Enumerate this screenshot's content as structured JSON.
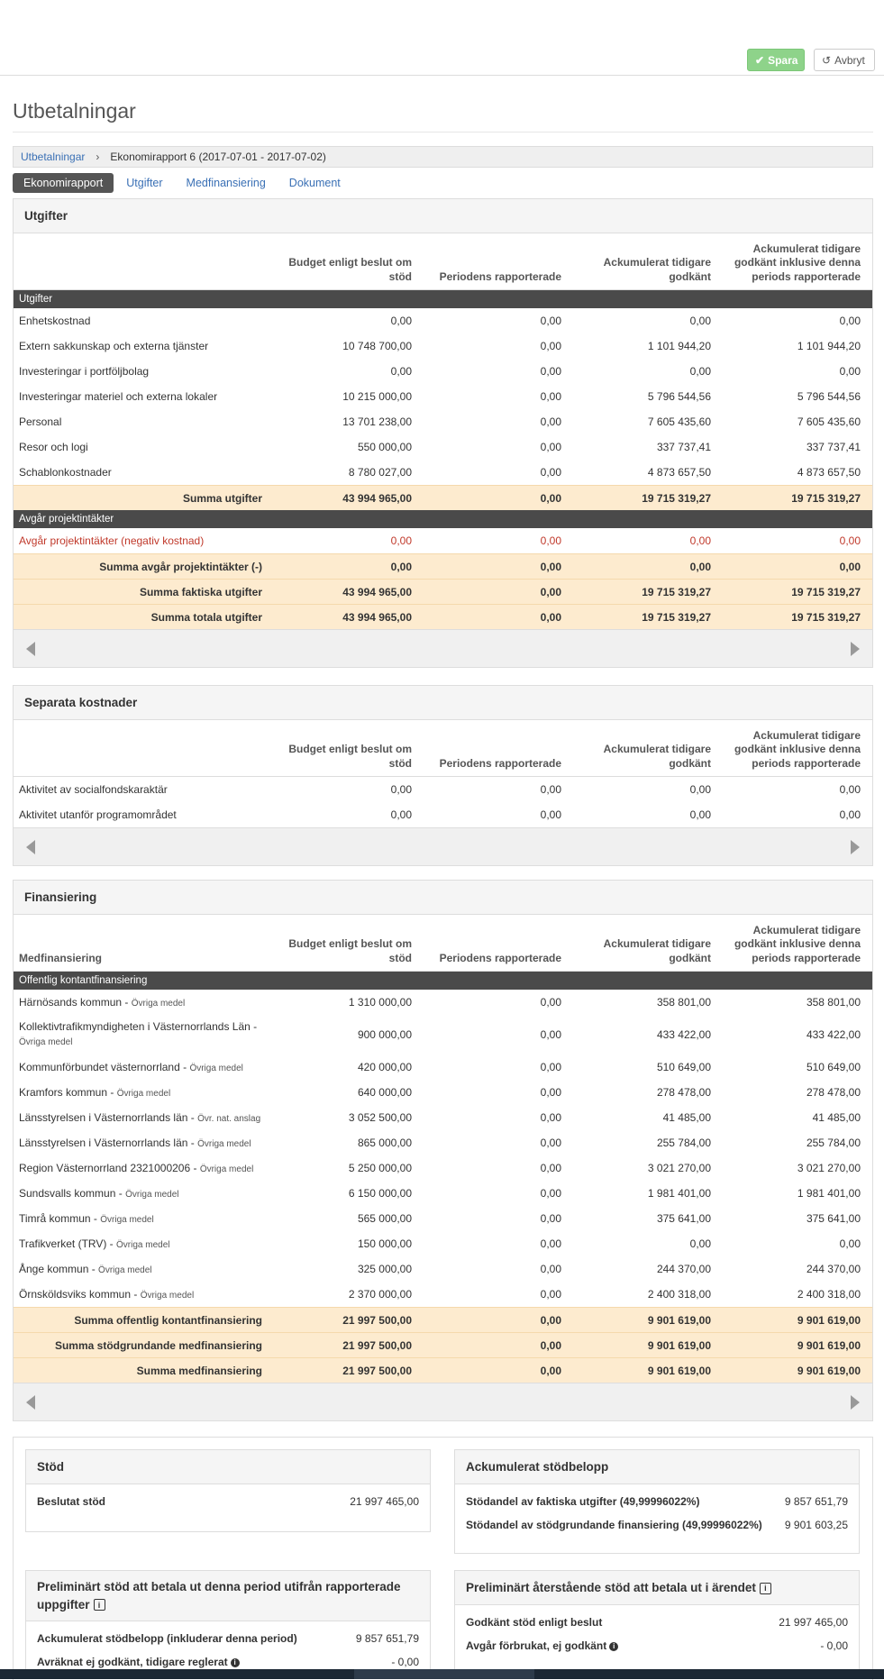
{
  "toolbar": {
    "save_label": "Spara",
    "cancel_label": "Avbryt"
  },
  "page_title": "Utbetalningar",
  "breadcrumb": {
    "link": "Utbetalningar",
    "separator": "›",
    "current": "Ekonomirapport 6 (2017-07-01 - 2017-07-02)"
  },
  "tabs": [
    "Ekonomirapport",
    "Utgifter",
    "Medfinansiering",
    "Dokument"
  ],
  "columns": [
    "Budget enligt beslut om stöd",
    "Periodens rapporterade",
    "Ackumulerat tidigare godkänt",
    "Ackumulerat tidigare godkänt inklusive denna periods rapporterade"
  ],
  "utgifter": {
    "title": "Utgifter",
    "category1": "Utgifter",
    "rows": [
      [
        "Enhetskostnad",
        "0,00",
        "0,00",
        "0,00",
        "0,00"
      ],
      [
        "Extern sakkunskap och externa tjänster",
        "10 748 700,00",
        "0,00",
        "1 101 944,20",
        "1 101 944,20"
      ],
      [
        "Investeringar i portföljbolag",
        "0,00",
        "0,00",
        "0,00",
        "0,00"
      ],
      [
        "Investeringar materiel och externa lokaler",
        "10 215 000,00",
        "0,00",
        "5 796 544,56",
        "5 796 544,56"
      ],
      [
        "Personal",
        "13 701 238,00",
        "0,00",
        "7 605 435,60",
        "7 605 435,60"
      ],
      [
        "Resor och logi",
        "550 000,00",
        "0,00",
        "337 737,41",
        "337 737,41"
      ],
      [
        "Schablonkostnader",
        "8 780 027,00",
        "0,00",
        "4 873 657,50",
        "4 873 657,50"
      ]
    ],
    "sum1": [
      "Summa utgifter",
      "43 994 965,00",
      "0,00",
      "19 715 319,27",
      "19 715 319,27"
    ],
    "category2": "Avgår projektintäkter",
    "neg_row": [
      "Avgår projektintäkter (negativ kostnad)",
      "0,00",
      "0,00",
      "0,00",
      "0,00"
    ],
    "sums": [
      [
        "Summa avgår projektintäkter (-)",
        "0,00",
        "0,00",
        "0,00",
        "0,00"
      ],
      [
        "Summa faktiska utgifter",
        "43 994 965,00",
        "0,00",
        "19 715 319,27",
        "19 715 319,27"
      ],
      [
        "Summa totala utgifter",
        "43 994 965,00",
        "0,00",
        "19 715 319,27",
        "19 715 319,27"
      ]
    ]
  },
  "separata": {
    "title": "Separata kostnader",
    "rows": [
      [
        "Aktivitet av socialfondskaraktär",
        "0,00",
        "0,00",
        "0,00",
        "0,00"
      ],
      [
        "Aktivitet utanför programområdet",
        "0,00",
        "0,00",
        "0,00",
        "0,00"
      ]
    ]
  },
  "finansiering": {
    "title": "Finansiering",
    "first_col": "Medfinansiering",
    "category": "Offentlig kontantfinansiering",
    "rows": [
      [
        "Härnösands kommun",
        "Övriga medel",
        "1 310 000,00",
        "0,00",
        "358 801,00",
        "358 801,00"
      ],
      [
        "Kollektivtrafikmyndigheten i Västernorrlands Län",
        "Övriga medel",
        "900 000,00",
        "0,00",
        "433 422,00",
        "433 422,00"
      ],
      [
        "Kommunförbundet västernorrland",
        "Övriga medel",
        "420 000,00",
        "0,00",
        "510 649,00",
        "510 649,00"
      ],
      [
        "Kramfors kommun",
        "Övriga medel",
        "640 000,00",
        "0,00",
        "278 478,00",
        "278 478,00"
      ],
      [
        "Länsstyrelsen i Västernorrlands län",
        "Övr. nat. anslag",
        "3 052 500,00",
        "0,00",
        "41 485,00",
        "41 485,00"
      ],
      [
        "Länsstyrelsen i Västernorrlands län",
        "Övriga medel",
        "865 000,00",
        "0,00",
        "255 784,00",
        "255 784,00"
      ],
      [
        "Region Västernorrland 2321000206",
        "Övriga medel",
        "5 250 000,00",
        "0,00",
        "3 021 270,00",
        "3 021 270,00"
      ],
      [
        "Sundsvalls kommun",
        "Övriga medel",
        "6 150 000,00",
        "0,00",
        "1 981 401,00",
        "1 981 401,00"
      ],
      [
        "Timrå kommun",
        "Övriga medel",
        "565 000,00",
        "0,00",
        "375 641,00",
        "375 641,00"
      ],
      [
        "Trafikverket (TRV)",
        "Övriga medel",
        "150 000,00",
        "0,00",
        "0,00",
        "0,00"
      ],
      [
        "Ånge kommun",
        "Övriga medel",
        "325 000,00",
        "0,00",
        "244 370,00",
        "244 370,00"
      ],
      [
        "Örnsköldsviks kommun",
        "Övriga medel",
        "2 370 000,00",
        "0,00",
        "2 400 318,00",
        "2 400 318,00"
      ]
    ],
    "sums": [
      [
        "Summa offentlig kontantfinansiering",
        "21 997 500,00",
        "0,00",
        "9 901 619,00",
        "9 901 619,00"
      ],
      [
        "Summa stödgrundande medfinansiering",
        "21 997 500,00",
        "0,00",
        "9 901 619,00",
        "9 901 619,00"
      ],
      [
        "Summa medfinansiering",
        "21 997 500,00",
        "0,00",
        "9 901 619,00",
        "9 901 619,00"
      ]
    ]
  },
  "stod": {
    "title": "Stöd",
    "label": "Beslutat stöd",
    "value": "21 997 465,00"
  },
  "ack": {
    "title": "Ackumulerat stödbelopp",
    "rows": [
      [
        "Stödandel av faktiska utgifter (49,99996022%)",
        "9 857 651,79"
      ],
      [
        "Stödandel av stödgrundande finansiering (49,99996022%)",
        "9 901 603,25"
      ]
    ]
  },
  "prelim": {
    "title": "Preliminärt stöd att betala ut denna period utifrån rapporterade uppgifter",
    "rows": [
      [
        "Ackumulerat stödbelopp (inkluderar denna period)",
        "9 857 651,79"
      ],
      [
        "Avräknat ej godkänt, tidigare reglerat",
        "- 0,00"
      ]
    ]
  },
  "remaining": {
    "title": "Preliminärt återstående stöd att betala ut i ärendet",
    "rows": [
      [
        "Godkänt stöd enligt beslut",
        "21 997 465,00"
      ],
      [
        "Avgår förbrukat, ej godkänt",
        "- 0,00"
      ]
    ]
  }
}
